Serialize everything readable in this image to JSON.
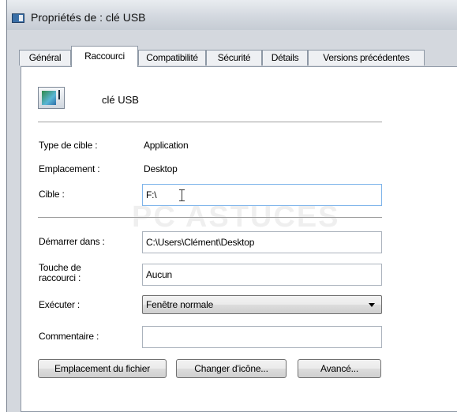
{
  "window": {
    "title": "Propriétés de : clé USB"
  },
  "tabs": [
    {
      "label": "Général"
    },
    {
      "label": "Raccourci"
    },
    {
      "label": "Compatibilité"
    },
    {
      "label": "Sécurité"
    },
    {
      "label": "Détails"
    },
    {
      "label": "Versions précédentes"
    }
  ],
  "active_tab": "Raccourci",
  "shortcut": {
    "name": "clé USB",
    "icon": "usb-drive-icon",
    "target_type": {
      "label": "Type de cible :",
      "value": "Application"
    },
    "location": {
      "label": "Emplacement :",
      "value": "Desktop"
    },
    "target": {
      "label": "Cible :",
      "value": "F:\\"
    },
    "start_in": {
      "label": "Démarrer dans :",
      "value": "C:\\Users\\Clément\\Desktop"
    },
    "hotkey": {
      "label": "Touche de raccourci :",
      "value": "Aucun"
    },
    "run": {
      "label": "Exécuter :",
      "value": "Fenêtre normale"
    },
    "comment": {
      "label": "Commentaire :",
      "value": ""
    }
  },
  "buttons": {
    "open_location": "Emplacement du fichier",
    "change_icon": "Changer d'icône...",
    "advanced": "Avancé..."
  },
  "watermark": "PC ASTUCES",
  "colors": {
    "window_chrome": "#d4d8de",
    "panel_bg": "#ffffff",
    "focus_border": "#7eb4ea"
  }
}
